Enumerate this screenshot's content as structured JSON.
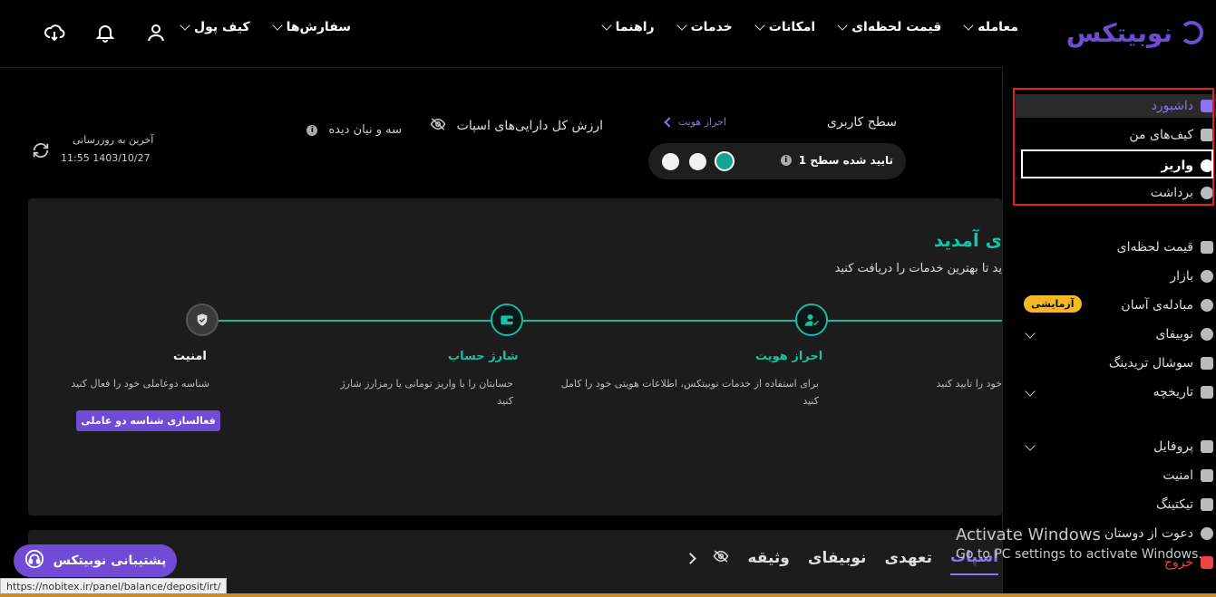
{
  "header": {
    "logo_text": "نوبیتکس",
    "nav": [
      {
        "label": "معامله"
      },
      {
        "label": "قیمت لحظه‌ای"
      },
      {
        "label": "امکانات"
      },
      {
        "label": "خدمات"
      },
      {
        "label": "راهنما"
      }
    ],
    "nav_left": [
      {
        "label": "سفارش‌ها"
      },
      {
        "label": "کیف پول"
      }
    ],
    "icons": [
      "download-icon",
      "bell-icon",
      "user-icon"
    ]
  },
  "sidebar": {
    "items": [
      {
        "label": "داشبورد",
        "icon": "dashboard-icon",
        "active": true
      },
      {
        "label": "کیف‌های من",
        "icon": "wallet-icon"
      },
      {
        "label": "واریز",
        "icon": "deposit-icon",
        "highlight": true
      },
      {
        "label": "برداشت",
        "icon": "withdraw-icon"
      },
      {
        "label": "قیمت لحظه‌ای",
        "icon": "chart-icon"
      },
      {
        "label": "بازار",
        "icon": "market-icon"
      },
      {
        "label": "مبادله‌ی آسان",
        "icon": "exchange-icon"
      },
      {
        "label": "نوبیفای",
        "icon": "nobify-icon"
      },
      {
        "label": "سوشال تریدینگ",
        "icon": "crown-icon"
      },
      {
        "label": "تاریخچه",
        "icon": "calendar-icon"
      },
      {
        "label": "پروفایل",
        "icon": "profile-icon"
      },
      {
        "label": "امنیت",
        "icon": "security-icon"
      },
      {
        "label": "تیکتینگ",
        "icon": "ticket-icon"
      },
      {
        "label": "دعوت از دوستان",
        "icon": "invite-icon"
      },
      {
        "label": "خروج",
        "icon": "logout-icon"
      }
    ],
    "trial_badge": "آزمایشی"
  },
  "summary": {
    "user_level_label": "سطح کاربری",
    "kyc_link": "احراز هویت",
    "level_status": "تایید شده سطح 1",
    "spot_total_label": "ارزش کل دارایی‌های اسپات",
    "hidden_value": "سه و نیان دیده",
    "last_update_label": "آخرین به روزرسانی",
    "last_update_time": "11:55 1403/10/27",
    "colors": {
      "accent": "#6f4bd6",
      "teal": "#13a58f"
    }
  },
  "welcome": {
    "title": "ی آمدید",
    "subtitle": "ید تا بهترین خدمات را دریافت کنید",
    "steps": [
      {
        "title": "",
        "desc": "خود را تایید کنید"
      },
      {
        "title": "احراز هویت",
        "desc": "برای استفاده از خدمات نوبیتکس، اطلاعات هویتی خود را کامل کنید"
      },
      {
        "title": "شارژ حساب",
        "desc": "حسابتان را با واریز تومانی یا رمزارز شارژ کنید"
      },
      {
        "title": "امنیت",
        "desc": "شناسه دوعاملی خود را فعال کنید"
      }
    ],
    "activate_2fa_button": "فعالسازی شناسه دو عاملی"
  },
  "tabs": [
    {
      "label": "اسپات",
      "active": true
    },
    {
      "label": "تعهدی"
    },
    {
      "label": "نوبیفای"
    },
    {
      "label": "وثیقه"
    }
  ],
  "support_button": "پشتیبانی نوبیتکس",
  "status_url": "https://nobitex.ir/panel/balance/deposit/irt/",
  "windows_watermark": {
    "line1": "Activate Windows",
    "line2": "Go to PC settings to activate Windows."
  }
}
